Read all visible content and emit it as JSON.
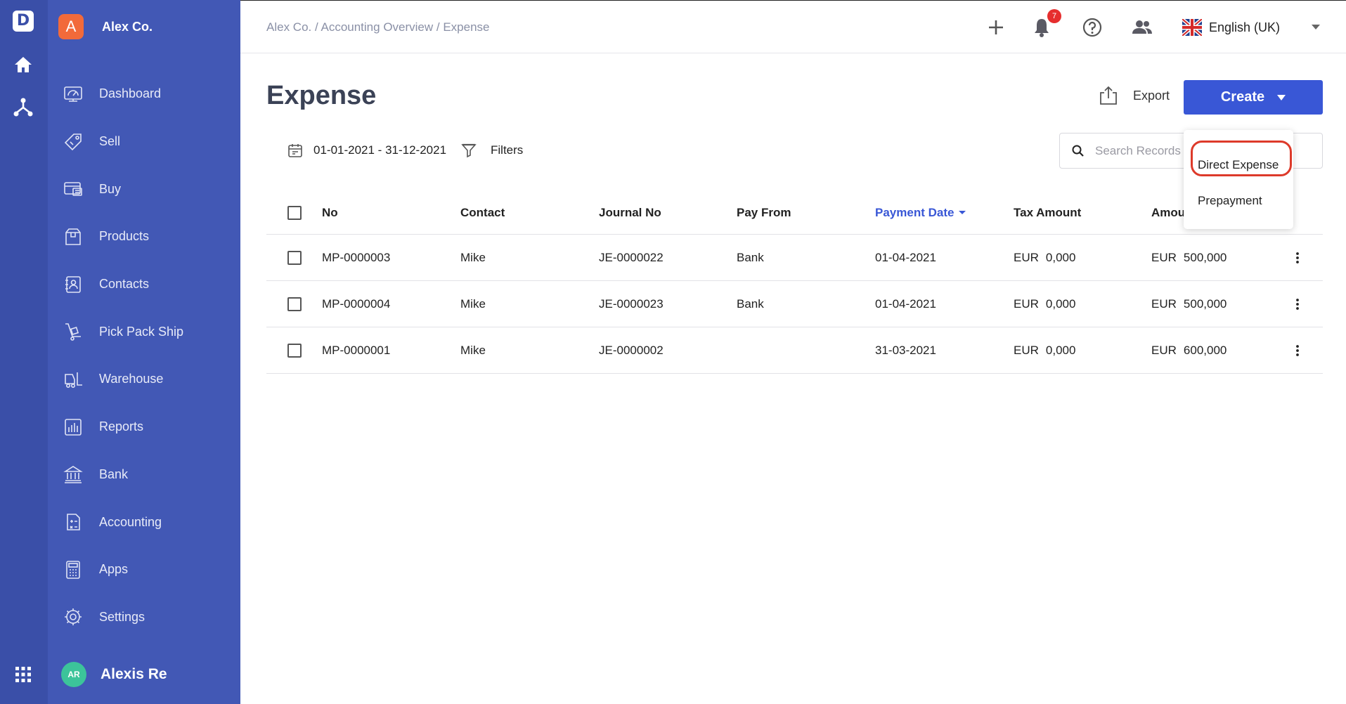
{
  "rail": {
    "logo_letter": "D",
    "icons": [
      "home-icon",
      "hierarchy-icon",
      "apps-grid-icon"
    ]
  },
  "sidebar": {
    "company_initial": "A",
    "company_name": "Alex Co.",
    "items": [
      {
        "label": "Dashboard",
        "icon": "dashboard-icon"
      },
      {
        "label": "Sell",
        "icon": "tag-icon"
      },
      {
        "label": "Buy",
        "icon": "wallet-icon"
      },
      {
        "label": "Products",
        "icon": "box-icon"
      },
      {
        "label": "Contacts",
        "icon": "contact-card-icon"
      },
      {
        "label": "Pick Pack Ship",
        "icon": "hand-truck-icon"
      },
      {
        "label": "Warehouse",
        "icon": "forklift-icon"
      },
      {
        "label": "Reports",
        "icon": "bar-report-icon"
      },
      {
        "label": "Bank",
        "icon": "bank-icon"
      },
      {
        "label": "Accounting",
        "icon": "calculator-doc-icon"
      },
      {
        "label": "Apps",
        "icon": "calculator-icon"
      },
      {
        "label": "Settings",
        "icon": "gear-icon"
      }
    ],
    "user_initials": "AR",
    "user_name": "Alexis Re"
  },
  "topbar": {
    "breadcrumb": "Alex Co. / Accounting Overview / Expense",
    "notification_count": "7",
    "language": "English (UK)"
  },
  "page": {
    "title": "Expense",
    "export_label": "Export",
    "create_label": "Create",
    "date_range": "01-01-2021 - 31-12-2021",
    "filters_label": "Filters",
    "search_placeholder": "Search Records"
  },
  "dropdown": {
    "items": [
      "Direct Expense",
      "Prepayment"
    ],
    "highlighted": "Direct Expense"
  },
  "table": {
    "columns": [
      "No",
      "Contact",
      "Journal No",
      "Pay From",
      "Payment Date",
      "Tax Amount",
      "Amount"
    ],
    "visible_columns": [
      "No",
      "Contact",
      "Journal No",
      "Pay From",
      "Payment Date",
      "Tax Amount",
      "Amou"
    ],
    "sorted_column": "Payment Date",
    "rows": [
      {
        "no": "MP-0000003",
        "contact": "Mike",
        "journal_no": "JE-0000022",
        "pay_from": "Bank",
        "payment_date": "01-04-2021",
        "tax_currency": "EUR",
        "tax_amount": "0,000",
        "amount_currency": "EUR",
        "amount": "500,000"
      },
      {
        "no": "MP-0000004",
        "contact": "Mike",
        "journal_no": "JE-0000023",
        "pay_from": "Bank",
        "payment_date": "01-04-2021",
        "tax_currency": "EUR",
        "tax_amount": "0,000",
        "amount_currency": "EUR",
        "amount": "500,000"
      },
      {
        "no": "MP-0000001",
        "contact": "Mike",
        "journal_no": "JE-0000002",
        "pay_from": "",
        "payment_date": "31-03-2021",
        "tax_currency": "EUR",
        "tax_amount": "0,000",
        "amount_currency": "EUR",
        "amount": "600,000"
      }
    ]
  },
  "colors": {
    "rail": "#3a4fa8",
    "sidebar": "#4258b5",
    "accent": "#3957d6",
    "company_avatar": "#f26a3a",
    "user_avatar": "#3cc49a",
    "badge": "#e62e2e",
    "highlight_ring": "#dd3a2a"
  }
}
